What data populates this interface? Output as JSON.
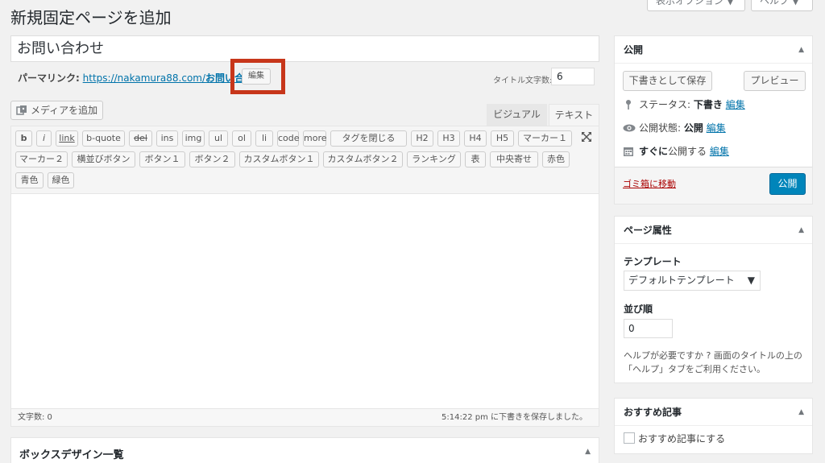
{
  "top": {
    "screen_options": "表示オプション ▼",
    "help": "ヘルプ ▼"
  },
  "page_title": "新規固定ページを追加",
  "title_value": "お問い合わせ",
  "permalink": {
    "label": "パーマリンク:",
    "url_base": "https://nakamura88.com/",
    "slug": "お問い合わせ",
    "suffix": "/",
    "edit_label": "編集"
  },
  "title_count": {
    "label": "タイトル文字数:",
    "value": "6"
  },
  "add_media": "メディアを追加",
  "tabs": {
    "visual": "ビジュアル",
    "text": "テキスト"
  },
  "quicktags": {
    "row1": [
      "b",
      "i",
      "link",
      "b-quote",
      "del",
      "ins",
      "img",
      "ul",
      "ol",
      "li",
      "code",
      "more",
      "タグを閉じる",
      "H2",
      "H3",
      "H4",
      "H5",
      "マーカー１"
    ],
    "row2": [
      "マーカー２",
      "横並びボタン",
      "ボタン１",
      "ボタン２",
      "カスタムボタン１",
      "カスタムボタン２",
      "ランキング",
      "表",
      "中央寄せ",
      "赤色"
    ],
    "row3": [
      "青色",
      "緑色"
    ]
  },
  "editor": {
    "word_count": "文字数: 0",
    "autosave": "5:14:22 pm に下書きを保存しました。"
  },
  "box_design": {
    "title": "ボックスデザイン一覧"
  },
  "publish": {
    "title": "公開",
    "save_draft": "下書きとして保存",
    "preview": "プレビュー",
    "status_label": "ステータス:",
    "status_value": "下書き",
    "visibility_label": "公開状態:",
    "visibility_value": "公開",
    "schedule_bold": "すぐに",
    "schedule_rest": "公開する",
    "edit": "編集",
    "trash": "ゴミ箱に移動",
    "publish_btn": "公開"
  },
  "attributes": {
    "title": "ページ属性",
    "template_label": "テンプレート",
    "template_value": "デフォルトテンプレート",
    "order_label": "並び順",
    "order_value": "0",
    "help_text": "ヘルプが必要ですか ? 画面のタイトルの上の「ヘルプ」タブをご利用ください。"
  },
  "featured": {
    "title": "おすすめ記事",
    "checkbox_label": "おすすめ記事にする"
  },
  "colors": {
    "highlight": "#c7361a",
    "primary": "#0085ba",
    "link": "#0073aa",
    "trash": "#a00000"
  }
}
